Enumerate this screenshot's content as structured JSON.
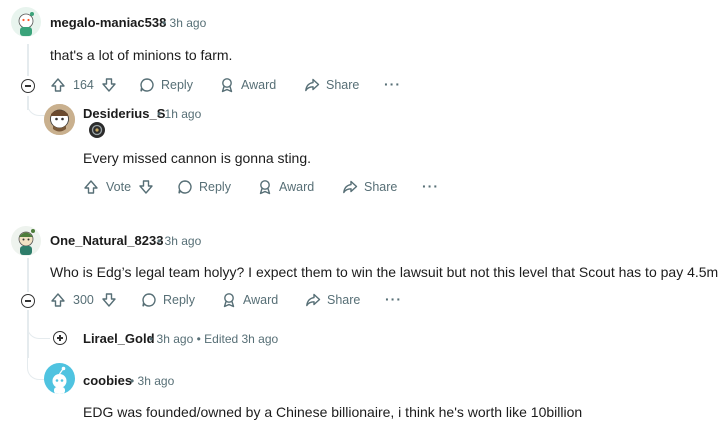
{
  "comments": [
    {
      "username": "megalo-maniac538",
      "time": "3h ago",
      "text": "that's a lot of minions to farm.",
      "votes": "164",
      "reply_label": "Reply",
      "award_label": "Award",
      "share_label": "Share"
    },
    {
      "username": "Desiderius_S",
      "time": "1h ago",
      "text": "Every missed cannon is gonna sting.",
      "votes": "Vote",
      "reply_label": "Reply",
      "award_label": "Award",
      "share_label": "Share"
    },
    {
      "username": "One_Natural_8233",
      "time": "3h ago",
      "text": "Who is Edg’s legal team holyy? I expect them to win the lawsuit but not this level that Scout has to pay 4.5m",
      "votes": "300",
      "reply_label": "Reply",
      "award_label": "Award",
      "share_label": "Share"
    },
    {
      "username": "Lirael_Gold",
      "time": "3h ago",
      "edited": "Edited 3h ago"
    },
    {
      "username": "coobies",
      "time": "3h ago",
      "text": "EDG was founded/owned by a Chinese billionaire, i think he's worth like 10billion"
    }
  ],
  "separator": "•",
  "more_glyph": "···",
  "colors": {
    "muted": "#576f76",
    "thread": "#e5ebee",
    "snoo_blue": "#4fc3e0"
  }
}
